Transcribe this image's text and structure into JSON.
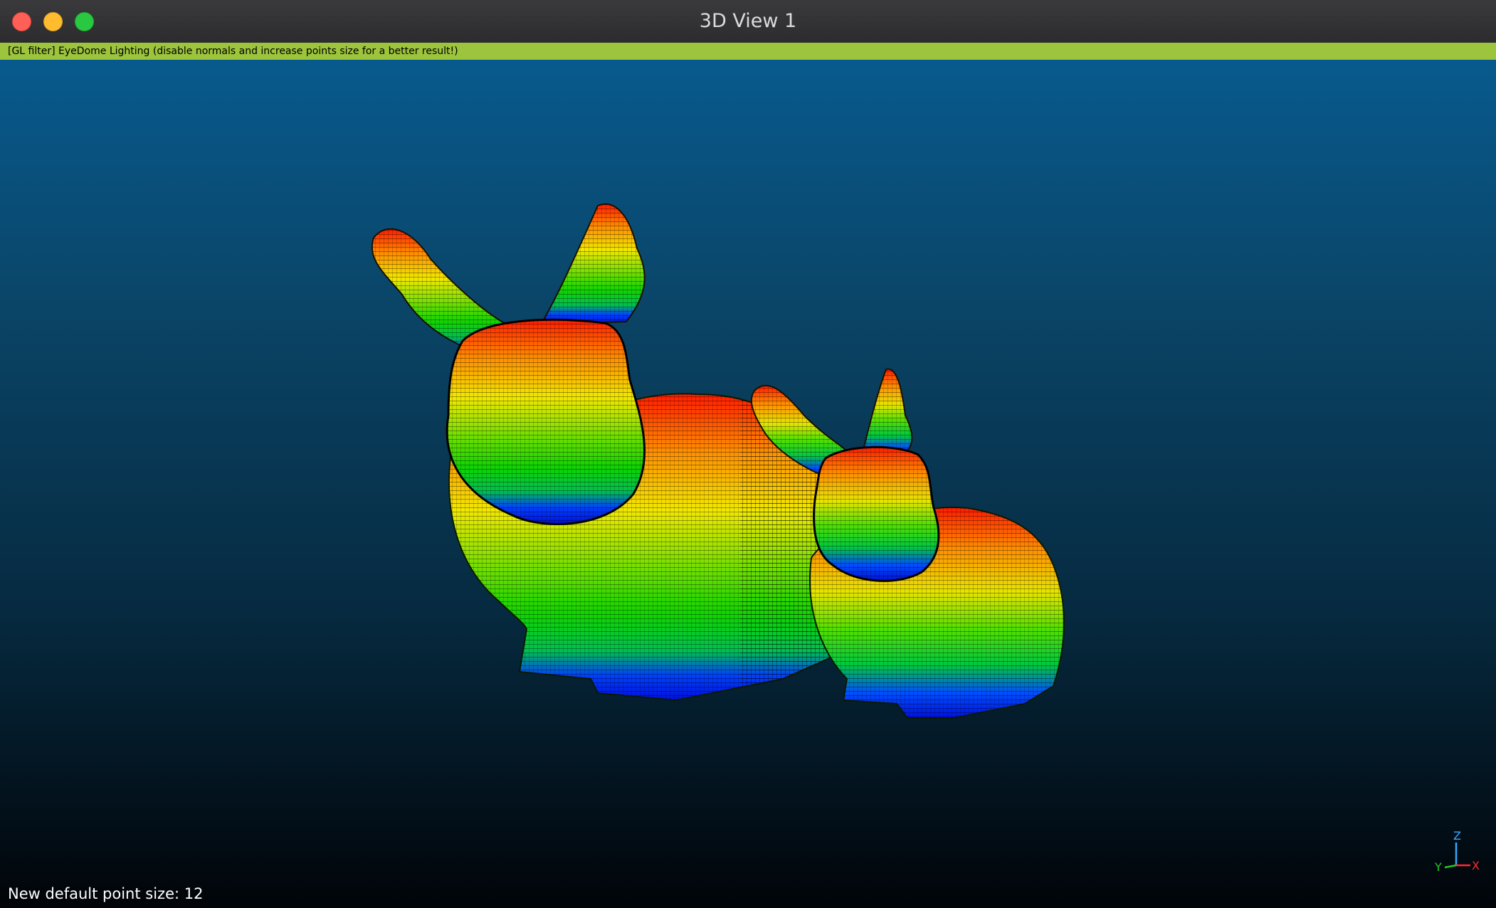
{
  "window": {
    "title": "3D View 1"
  },
  "filter_banner": {
    "text": "[GL filter] EyeDome Lighting (disable normals and increase points size for a better result!)"
  },
  "status": {
    "message": "New default point size: 12"
  },
  "axes_widget": {
    "z_label": "Z",
    "y_label": "Y",
    "x_label": "X",
    "colors": {
      "x": "#ff2a2a",
      "y": "#22cc22",
      "z": "#33aaff"
    }
  },
  "scene": {
    "objects": [
      "large-bunny-point-cloud",
      "small-bunny-point-cloud"
    ],
    "colormap": [
      "#0011ff",
      "#00ff00",
      "#ffff00",
      "#ff8800",
      "#ff1100"
    ]
  }
}
